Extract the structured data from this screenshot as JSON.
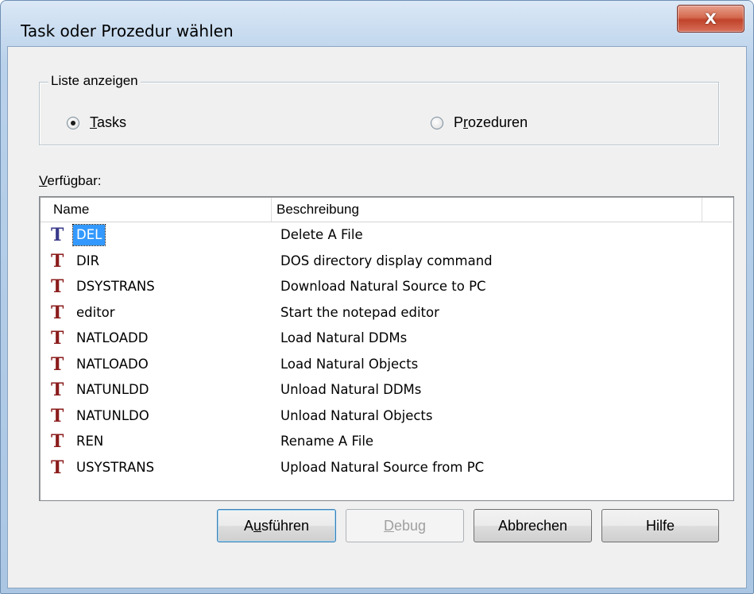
{
  "window": {
    "title": "Task oder Prozedur wählen",
    "close_glyph": "X"
  },
  "group": {
    "legend": "Liste anzeigen",
    "options": [
      {
        "label_prefix": "",
        "label_mnemonic": "T",
        "label_rest": "asks",
        "selected": true
      },
      {
        "label_prefix": "P",
        "label_mnemonic": "r",
        "label_rest": "ozeduren",
        "selected": false
      }
    ]
  },
  "available": {
    "label_mnemonic": "V",
    "label_rest": "erfügbar:"
  },
  "list": {
    "columns": [
      "Name",
      "Beschreibung",
      ""
    ],
    "rows": [
      {
        "icon": "T",
        "name": "DEL",
        "description": "Delete A File",
        "selected": true
      },
      {
        "icon": "T",
        "name": "DIR",
        "description": "DOS directory display command",
        "selected": false
      },
      {
        "icon": "T",
        "name": "DSYSTRANS",
        "description": "Download Natural Source to PC",
        "selected": false
      },
      {
        "icon": "T",
        "name": "editor",
        "description": "Start the notepad editor",
        "selected": false
      },
      {
        "icon": "T",
        "name": "NATLOADD",
        "description": "Load Natural DDMs",
        "selected": false
      },
      {
        "icon": "T",
        "name": "NATLOADO",
        "description": "Load Natural Objects",
        "selected": false
      },
      {
        "icon": "T",
        "name": "NATUNLDD",
        "description": "Unload Natural DDMs",
        "selected": false
      },
      {
        "icon": "T",
        "name": "NATUNLDO",
        "description": "Unload Natural Objects",
        "selected": false
      },
      {
        "icon": "T",
        "name": "REN",
        "description": "Rename A File",
        "selected": false
      },
      {
        "icon": "T",
        "name": "USYSTRANS",
        "description": "Upload Natural Source from PC",
        "selected": false
      }
    ]
  },
  "buttons": {
    "run_prefix": "A",
    "run_mnemonic": "u",
    "run_rest": "sführen",
    "debug_mnemonic": "D",
    "debug_rest": "ebug",
    "cancel": "Abbrechen",
    "help": "Hilfe"
  },
  "colors": {
    "task_icon": "#8b1c1c",
    "selection": "#3399ff"
  }
}
